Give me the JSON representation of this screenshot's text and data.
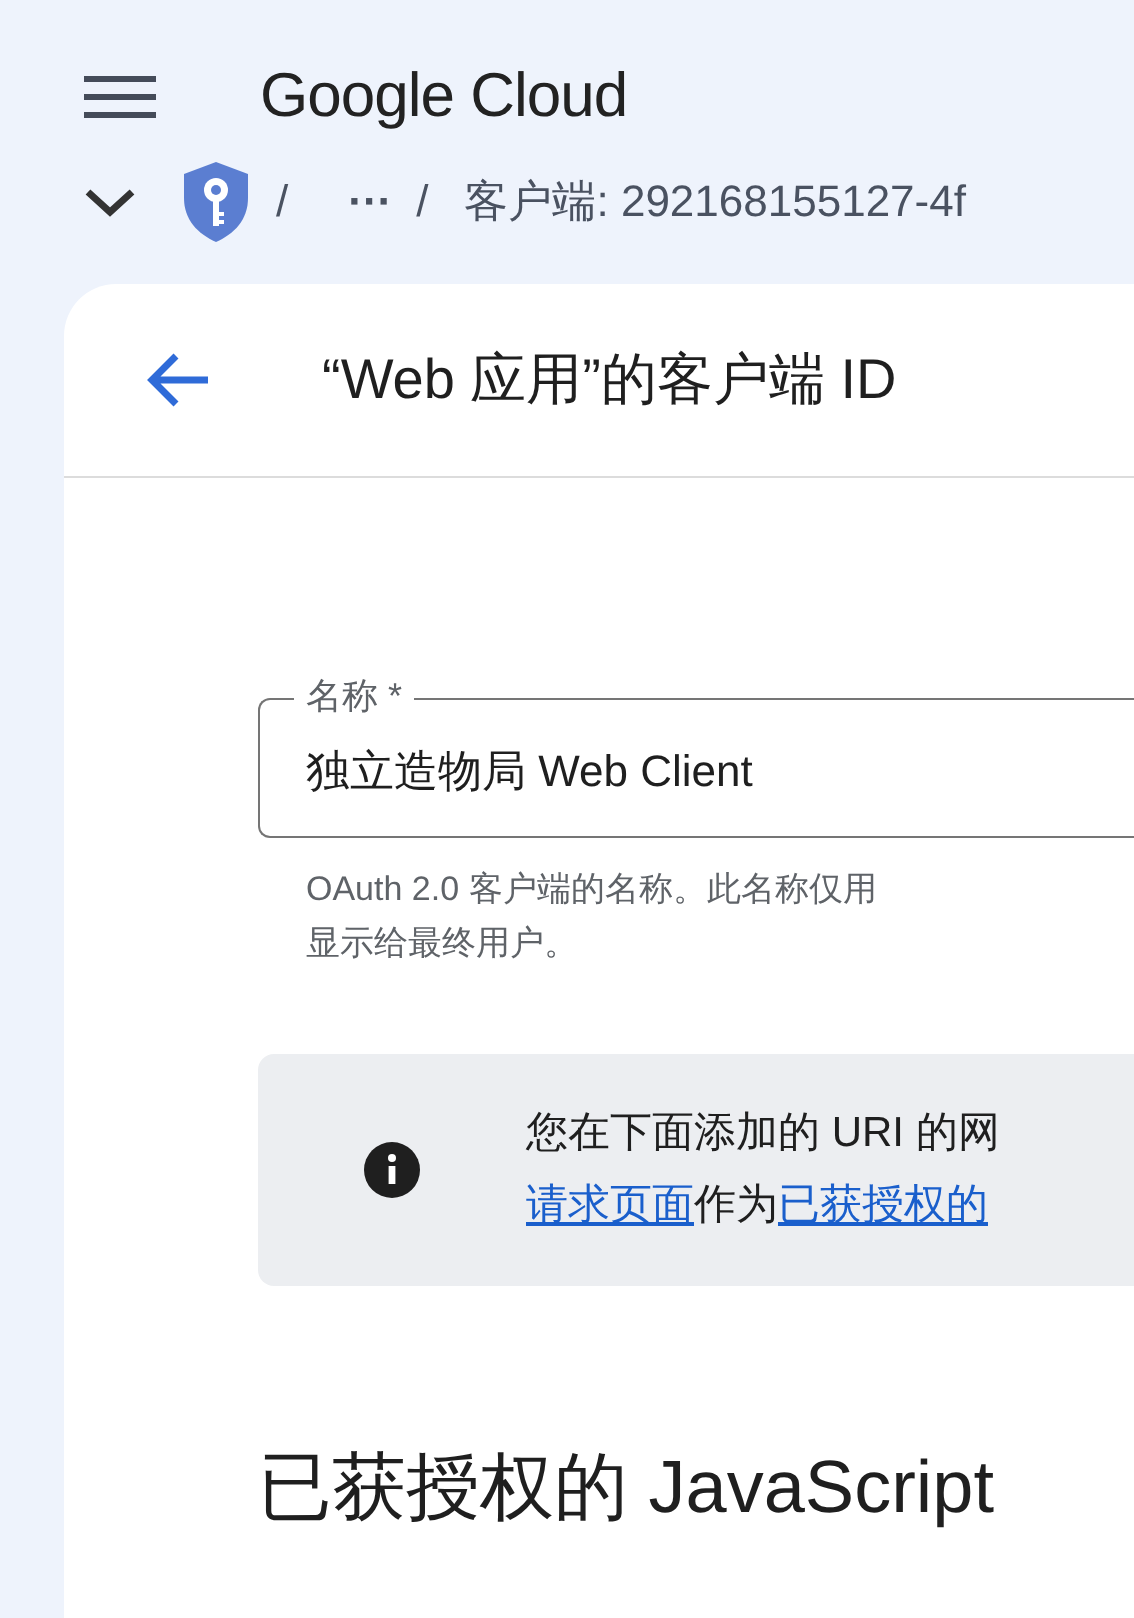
{
  "header": {
    "logo": "Google Cloud"
  },
  "breadcrumb": {
    "separators": [
      "/",
      "/"
    ],
    "ellipsis": "···",
    "current": "客户端: 292168155127-4f"
  },
  "card": {
    "title": "“Web 应用”的客户端 ID",
    "name_field": {
      "label": "名称 *",
      "value": "独立造物局 Web Client",
      "helper_lines": [
        "OAuth 2.0 客户端的名称。此名称仅用",
        "显示给最终用户。"
      ]
    },
    "info": {
      "lines": [
        [
          {
            "text": "您在下面添加的 URI 的网",
            "link": false
          }
        ],
        [
          {
            "text": "请求页面",
            "link": true
          },
          {
            "text": "作为",
            "link": false
          },
          {
            "text": "已获授权的",
            "link": true
          }
        ]
      ]
    },
    "section_heading": "已获授权的 JavaScript"
  }
}
